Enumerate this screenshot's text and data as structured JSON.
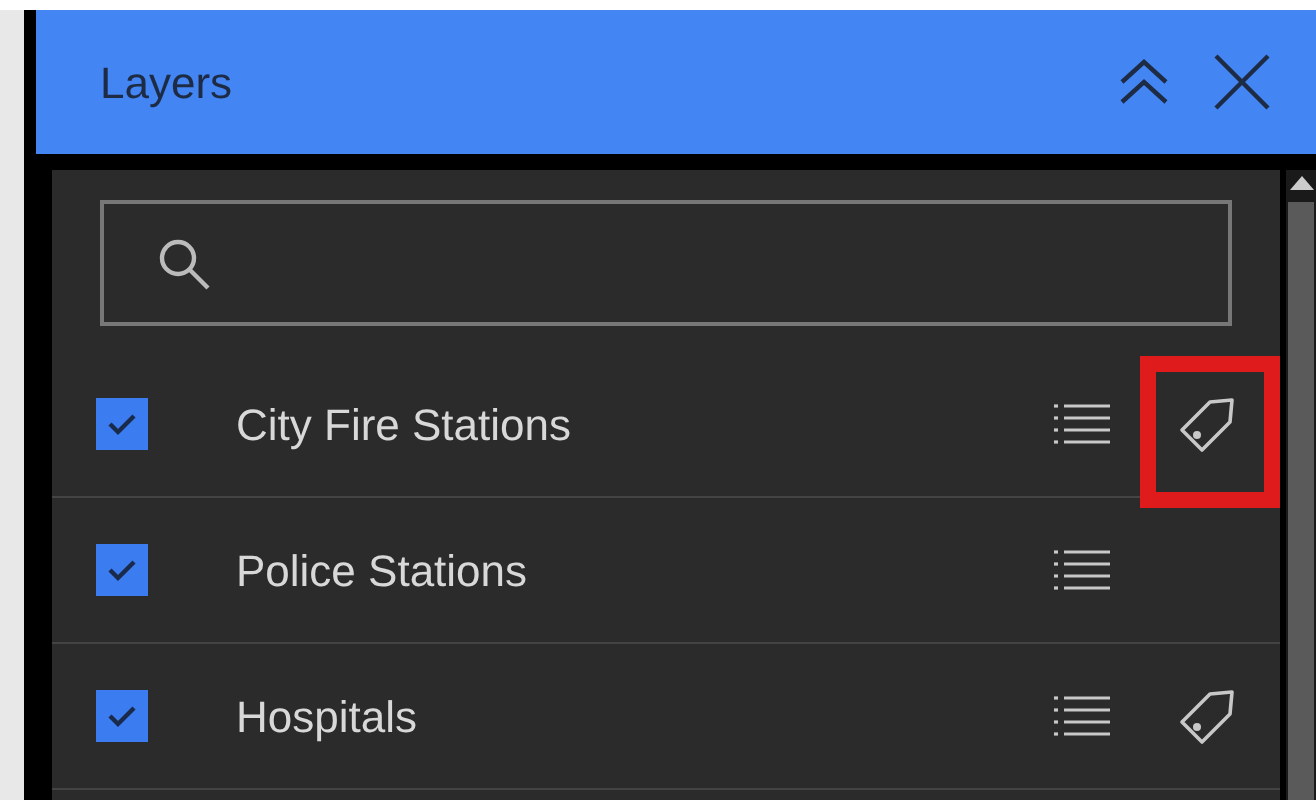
{
  "panel": {
    "title": "Layers"
  },
  "layers": [
    {
      "name": "City Fire Stations",
      "checked": true,
      "has_label_tool": true,
      "highlighted": true
    },
    {
      "name": "Police Stations",
      "checked": true,
      "has_label_tool": false,
      "highlighted": false
    },
    {
      "name": "Hospitals",
      "checked": true,
      "has_label_tool": true,
      "highlighted": false
    }
  ]
}
